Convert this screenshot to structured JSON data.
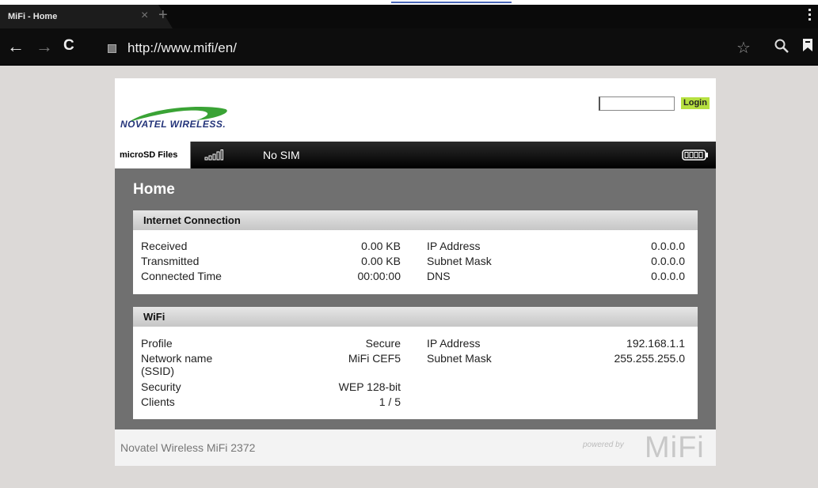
{
  "browser": {
    "tab_title": "MiFi - Home",
    "tab_close": "×",
    "new_tab": "+",
    "url": "http://www.mifi/en/"
  },
  "header": {
    "logo_text": "NOVATEL WIRELESS.",
    "login_label": "Login",
    "login_value": ""
  },
  "toolbar": {
    "microsd_label": "microSD Files",
    "sim_status": "No SIM"
  },
  "page": {
    "title": "Home"
  },
  "internet": {
    "heading": "Internet Connection",
    "left": [
      {
        "label": "Received",
        "value": "0.00 KB"
      },
      {
        "label": "Transmitted",
        "value": "0.00 KB"
      },
      {
        "label": "Connected Time",
        "value": "00:00:00"
      }
    ],
    "right": [
      {
        "label": "IP Address",
        "value": "0.0.0.0"
      },
      {
        "label": "Subnet Mask",
        "value": "0.0.0.0"
      },
      {
        "label": "DNS",
        "value": "0.0.0.0"
      }
    ]
  },
  "wifi": {
    "heading": "WiFi",
    "left": [
      {
        "label": "Profile",
        "value": "Secure"
      },
      {
        "label": "Network name (SSID)",
        "value": "MiFi CEF5"
      },
      {
        "label": "Security",
        "value": "WEP 128-bit"
      },
      {
        "label": "Clients",
        "value": "1 / 5"
      }
    ],
    "right": [
      {
        "label": "IP Address",
        "value": "192.168.1.1"
      },
      {
        "label": "Subnet Mask",
        "value": "255.255.255.0"
      }
    ]
  },
  "footer": {
    "device_name": "Novatel Wireless MiFi 2372",
    "powered_by": "powered by",
    "brand": "MiFi"
  },
  "colors": {
    "login_button": "#b6e040",
    "logo_green": "#3aa335",
    "logo_blue": "#24347a",
    "content_bg": "#707070"
  },
  "icons": [
    "close-icon",
    "plus-icon",
    "menu-icon",
    "back-icon",
    "forward-icon",
    "reload-icon",
    "favicon-icon",
    "star-icon",
    "search-icon",
    "bookmark-icon",
    "signal-icon",
    "battery-icon"
  ]
}
